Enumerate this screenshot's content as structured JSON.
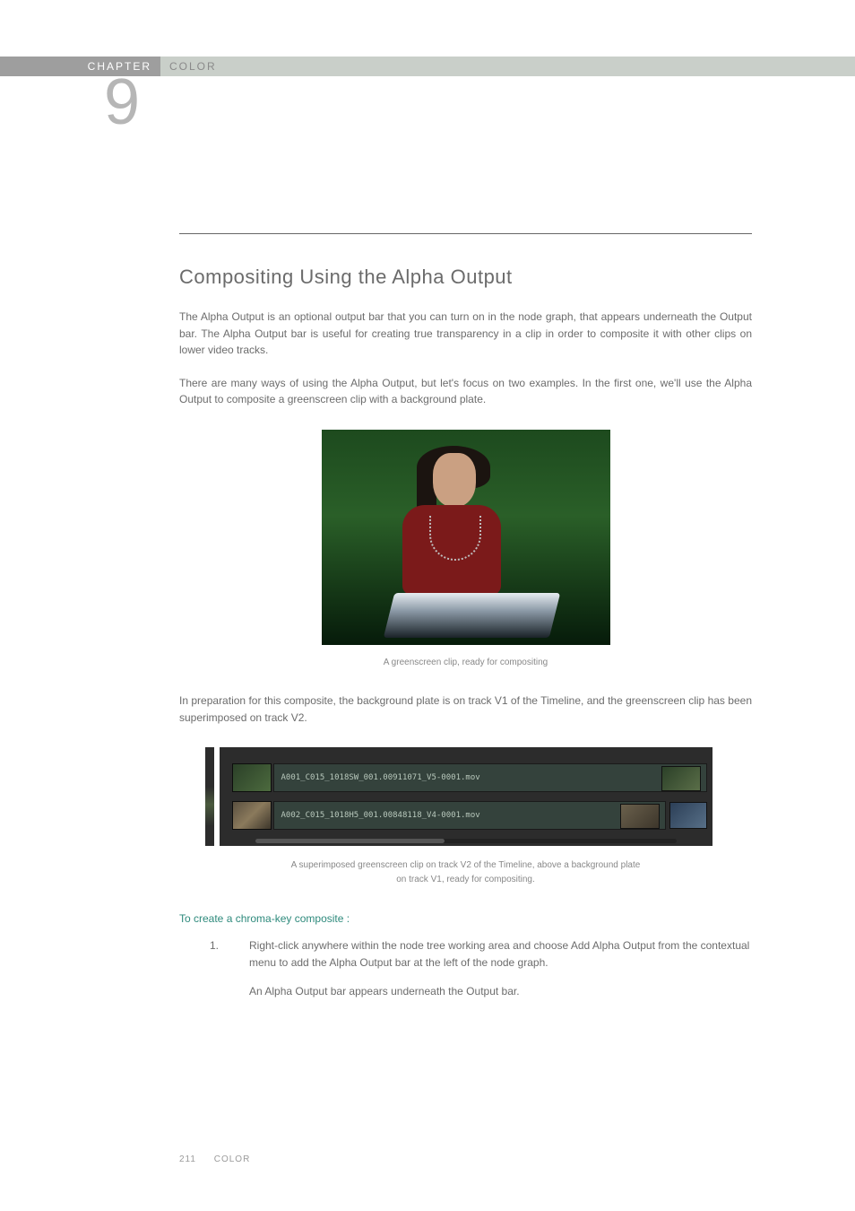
{
  "header": {
    "chapter_label": "CHAPTER",
    "section_label": "COLOR",
    "chapter_number": "9"
  },
  "heading": "Compositing Using the Alpha Output",
  "paragraphs": {
    "p1": "The Alpha Output is an optional output bar that you can turn on in the node graph, that appears underneath the Output bar. The Alpha Output bar is useful for creating true transparency in a clip in order to composite it with other clips on lower video tracks.",
    "p2": "There are many ways of using the Alpha Output, but let's focus on two examples. In the first one, we'll use the Alpha Output to composite a greenscreen clip with a background plate.",
    "p3": "In preparation for this composite, the background plate is on track V1 of the Timeline, and the greenscreen clip has been superimposed on track V2."
  },
  "captions": {
    "c1": "A greenscreen clip, ready for compositing",
    "c2a": "A superimposed greenscreen clip on track V2 of the Timeline, above a background plate",
    "c2b": "on track V1, ready for compositing."
  },
  "timeline": {
    "clip1": "A001_C015_1018SW_001.00911071_V5-0001.mov",
    "clip2": "A002_C015_1018H5_001.00848118_V4-0001.mov"
  },
  "procedure": {
    "title": "To create a chroma-key composite :",
    "steps": [
      {
        "num": "1.",
        "line1": "Right-click anywhere within the node tree working area and choose Add Alpha Output from the contextual menu to add the Alpha Output bar at the left of the node graph.",
        "line2": "An Alpha Output bar appears underneath the Output bar."
      }
    ]
  },
  "footer": {
    "page": "211",
    "section": "COLOR"
  }
}
